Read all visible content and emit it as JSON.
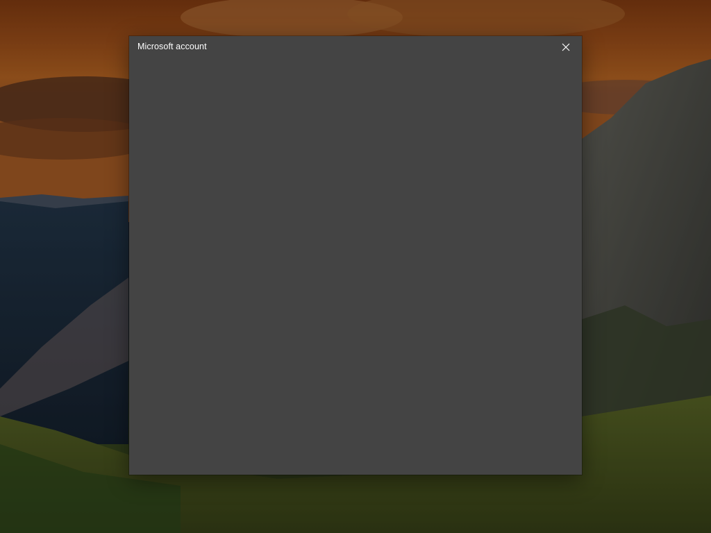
{
  "dialog": {
    "title": "Microsoft account",
    "close_icon": "close-icon",
    "background_color": "#444444",
    "title_color": "#ffffff"
  },
  "wallpaper": {
    "description_colors": [
      "#c8612a",
      "#2a3545",
      "#4a5a25"
    ]
  }
}
